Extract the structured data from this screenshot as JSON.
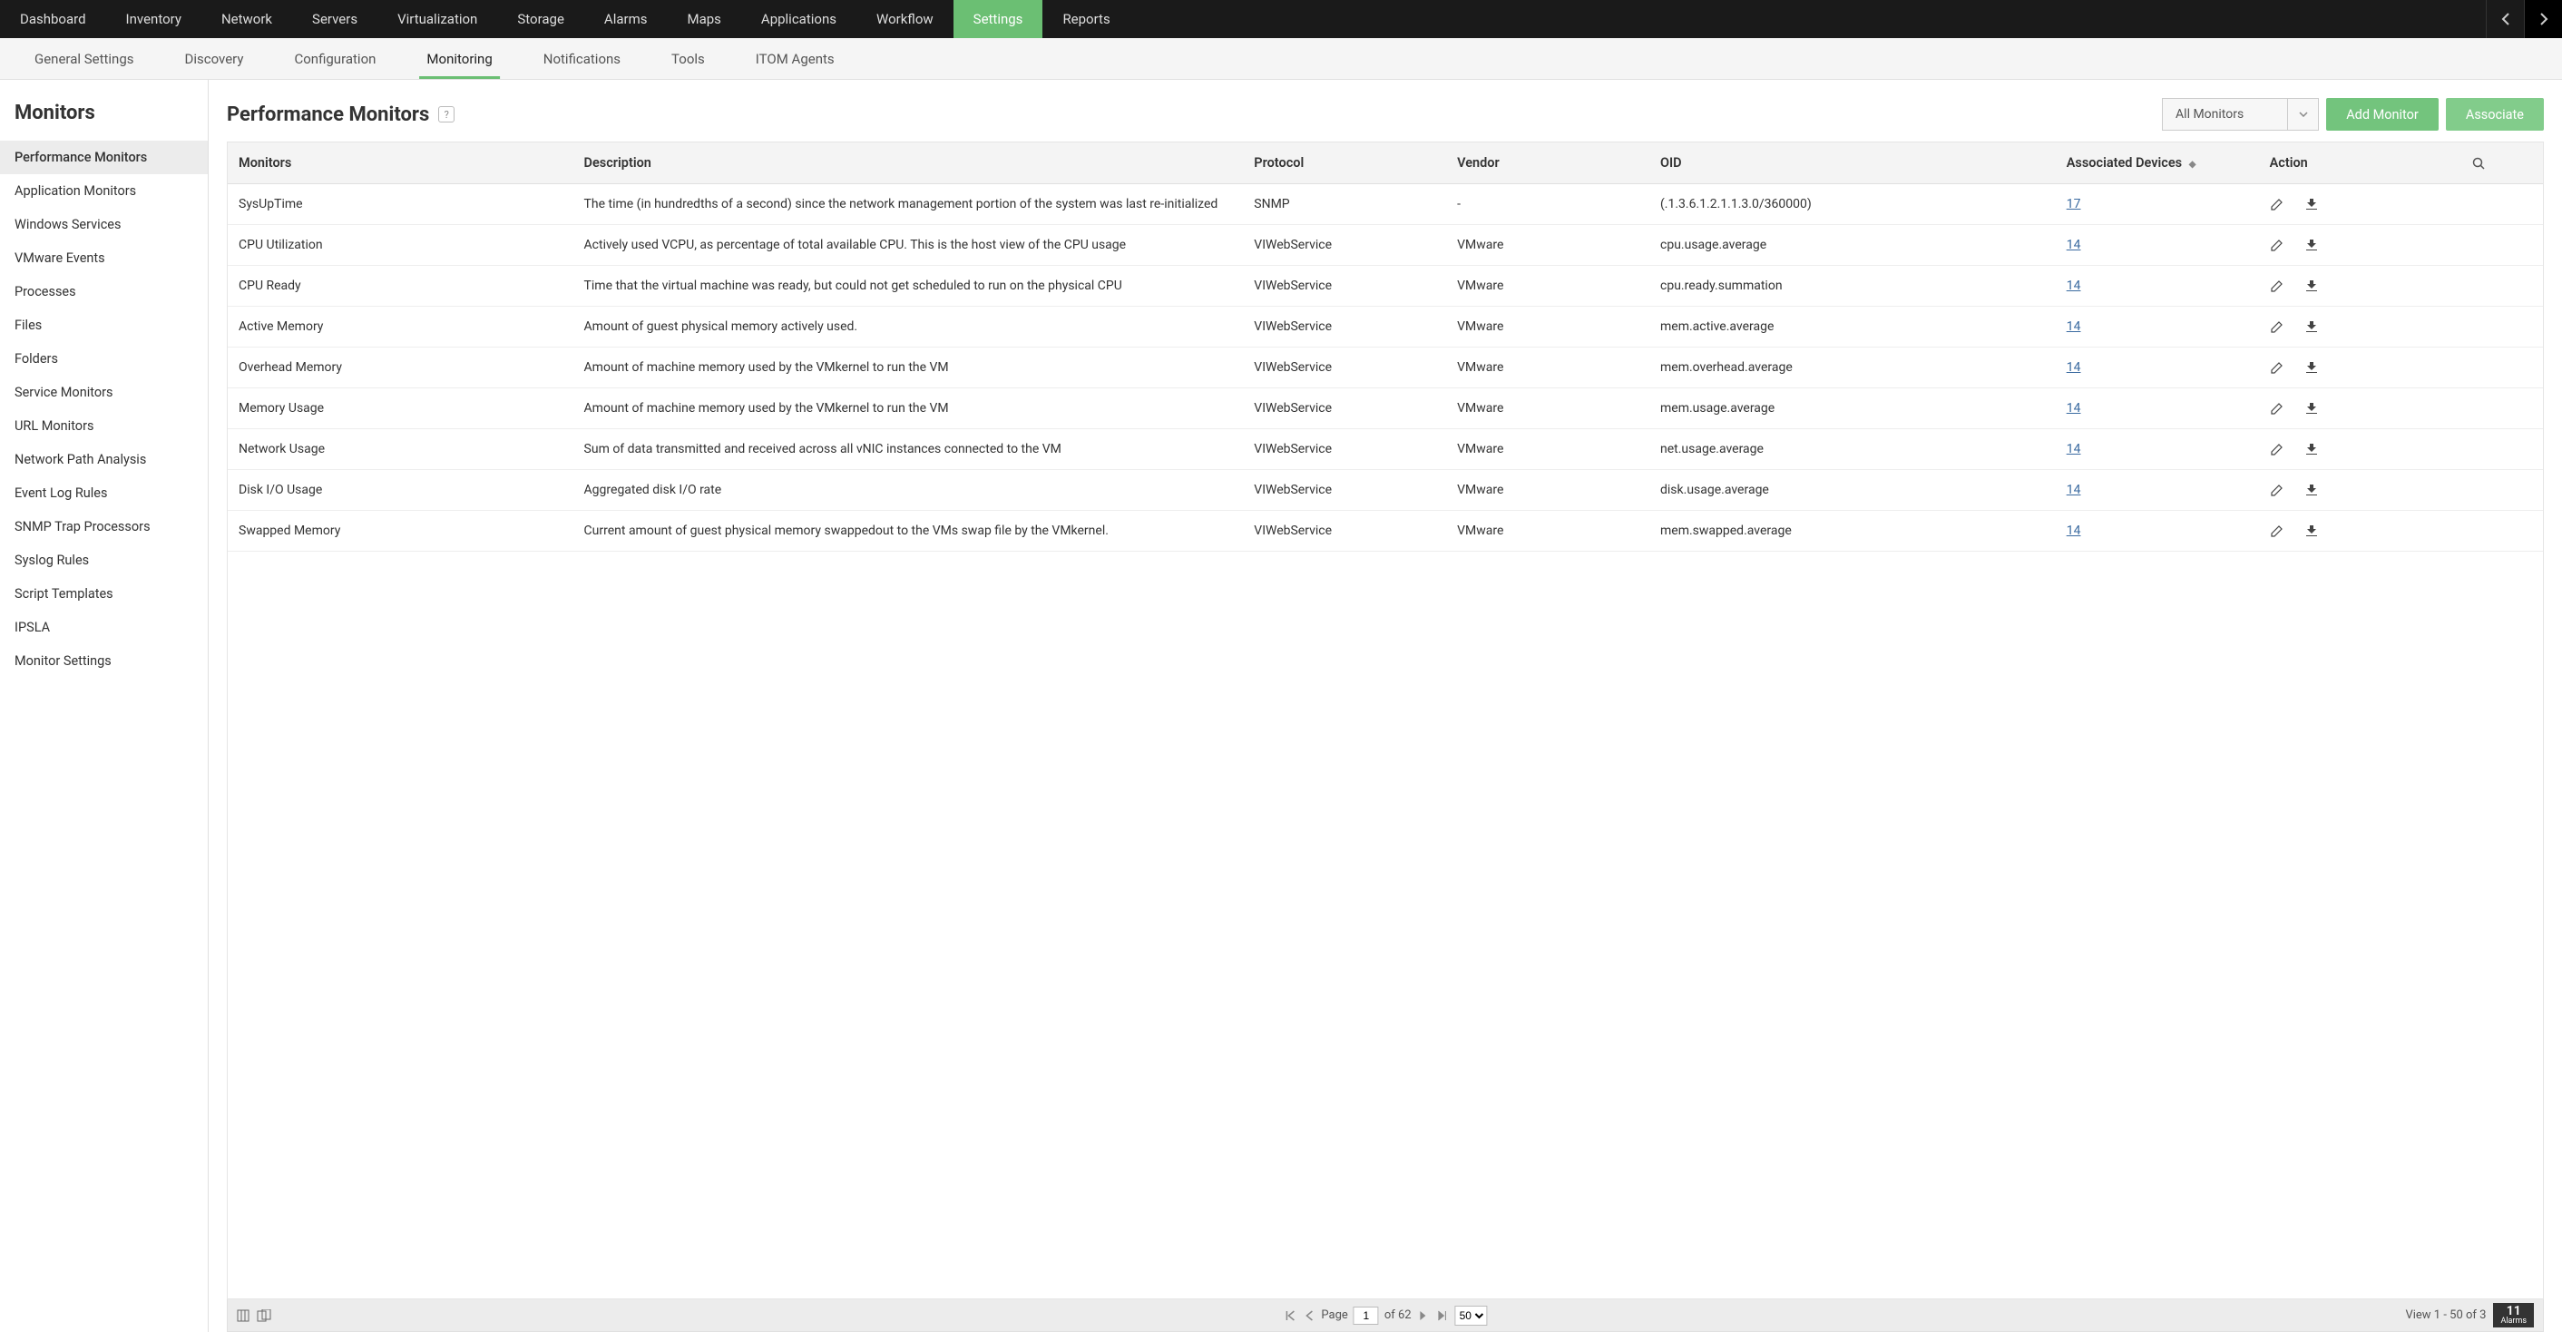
{
  "topNav": {
    "items": [
      "Dashboard",
      "Inventory",
      "Network",
      "Servers",
      "Virtualization",
      "Storage",
      "Alarms",
      "Maps",
      "Applications",
      "Workflow",
      "Settings",
      "Reports"
    ],
    "active": "Settings"
  },
  "subNav": {
    "items": [
      "General Settings",
      "Discovery",
      "Configuration",
      "Monitoring",
      "Notifications",
      "Tools",
      "ITOM Agents"
    ],
    "active": "Monitoring"
  },
  "sidebar": {
    "title": "Monitors",
    "items": [
      "Performance Monitors",
      "Application Monitors",
      "Windows Services",
      "VMware Events",
      "Processes",
      "Files",
      "Folders",
      "Service Monitors",
      "URL Monitors",
      "Network Path Analysis",
      "Event Log Rules",
      "SNMP Trap Processors",
      "Syslog Rules",
      "Script Templates",
      "IPSLA",
      "Monitor Settings"
    ],
    "active": "Performance Monitors"
  },
  "page": {
    "title": "Performance Monitors",
    "filter": "All Monitors",
    "addBtn": "Add Monitor",
    "assocBtn": "Associate"
  },
  "table": {
    "headers": {
      "monitors": "Monitors",
      "description": "Description",
      "protocol": "Protocol",
      "vendor": "Vendor",
      "oid": "OID",
      "assoc": "Associated Devices",
      "action": "Action"
    },
    "rows": [
      {
        "name": "SysUpTime",
        "desc": "The time (in hundredths of a second) since the network management portion of the system was last re-initialized",
        "protocol": "SNMP",
        "vendor": "-",
        "oid": "(.1.3.6.1.2.1.1.3.0/360000)",
        "assoc": "17"
      },
      {
        "name": "CPU Utilization",
        "desc": "Actively used VCPU, as percentage of total available CPU. This is the host view of the CPU usage",
        "protocol": "VIWebService",
        "vendor": "VMware",
        "oid": "cpu.usage.average",
        "assoc": "14"
      },
      {
        "name": "CPU Ready",
        "desc": "Time that the virtual machine was ready, but could not get scheduled to run on the physical CPU",
        "protocol": "VIWebService",
        "vendor": "VMware",
        "oid": "cpu.ready.summation",
        "assoc": "14"
      },
      {
        "name": "Active Memory",
        "desc": "Amount of guest physical memory actively used.",
        "protocol": "VIWebService",
        "vendor": "VMware",
        "oid": "mem.active.average",
        "assoc": "14"
      },
      {
        "name": "Overhead Memory",
        "desc": "Amount of machine memory used by the VMkernel to run the VM",
        "protocol": "VIWebService",
        "vendor": "VMware",
        "oid": "mem.overhead.average",
        "assoc": "14"
      },
      {
        "name": "Memory Usage",
        "desc": "Amount of machine memory used by the VMkernel to run the VM",
        "protocol": "VIWebService",
        "vendor": "VMware",
        "oid": "mem.usage.average",
        "assoc": "14"
      },
      {
        "name": "Network Usage",
        "desc": "Sum of data transmitted and received across all vNIC instances connected to the VM",
        "protocol": "VIWebService",
        "vendor": "VMware",
        "oid": "net.usage.average",
        "assoc": "14"
      },
      {
        "name": "Disk I/O Usage",
        "desc": "Aggregated disk I/O rate",
        "protocol": "VIWebService",
        "vendor": "VMware",
        "oid": "disk.usage.average",
        "assoc": "14"
      },
      {
        "name": "Swapped Memory",
        "desc": "Current amount of guest physical memory swappedout to the VMs swap file by the VMkernel.",
        "protocol": "VIWebService",
        "vendor": "VMware",
        "oid": "mem.swapped.average",
        "assoc": "14"
      }
    ]
  },
  "footer": {
    "pageLabel": "Page",
    "pageValue": "1",
    "ofLabel": "of 62",
    "pageSize": "50",
    "viewText": "View 1 - 50 of 3",
    "alarmsCount": "11",
    "alarmsLabel": "Alarms"
  }
}
